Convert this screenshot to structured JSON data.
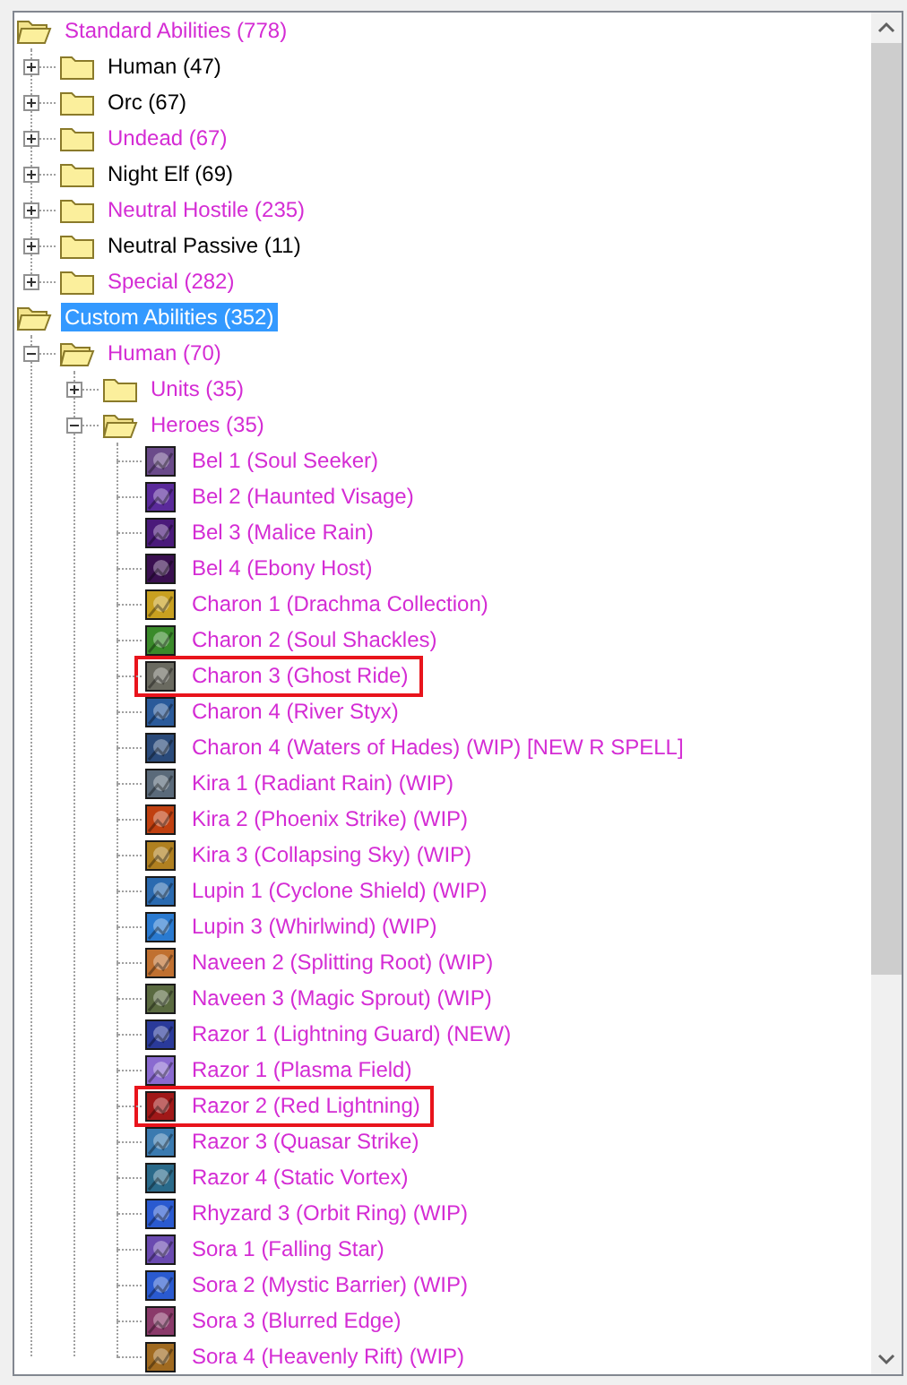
{
  "tree": [
    {
      "kind": "folder",
      "label": "Standard Abilities (778)",
      "modified": true,
      "selected": false,
      "expanded": true,
      "children": [
        {
          "kind": "folder",
          "label": "Human (47)",
          "modified": false,
          "selected": false,
          "expanded": false
        },
        {
          "kind": "folder",
          "label": "Orc (67)",
          "modified": false,
          "selected": false,
          "expanded": false
        },
        {
          "kind": "folder",
          "label": "Undead (67)",
          "modified": true,
          "selected": false,
          "expanded": false
        },
        {
          "kind": "folder",
          "label": "Night Elf (69)",
          "modified": false,
          "selected": false,
          "expanded": false
        },
        {
          "kind": "folder",
          "label": "Neutral Hostile (235)",
          "modified": true,
          "selected": false,
          "expanded": false
        },
        {
          "kind": "folder",
          "label": "Neutral Passive (11)",
          "modified": false,
          "selected": false,
          "expanded": false
        },
        {
          "kind": "folder",
          "label": "Special (282)",
          "modified": true,
          "selected": false,
          "expanded": false
        }
      ]
    },
    {
      "kind": "folder",
      "label": "Custom Abilities (352)",
      "selected": true,
      "expanded": true,
      "children": [
        {
          "kind": "folder",
          "label": "Human (70)",
          "modified": true,
          "selected": false,
          "expanded": true,
          "children": [
            {
              "kind": "folder",
              "label": "Units (35)",
              "modified": true,
              "selected": false,
              "expanded": false
            },
            {
              "kind": "folder",
              "label": "Heroes (35)",
              "modified": true,
              "selected": false,
              "expanded": true,
              "children": [
                {
                  "kind": "ability",
                  "label": "Bel 1 (Soul Seeker)",
                  "modified": true,
                  "selected": false,
                  "highlighted": false,
                  "color": "#6a4a8a"
                },
                {
                  "kind": "ability",
                  "label": "Bel 2 (Haunted Visage)",
                  "modified": true,
                  "selected": false,
                  "highlighted": false,
                  "color": "#5a2a9a"
                },
                {
                  "kind": "ability",
                  "label": "Bel 3 (Malice Rain)",
                  "modified": true,
                  "selected": false,
                  "highlighted": false,
                  "color": "#4a1a7a"
                },
                {
                  "kind": "ability",
                  "label": "Bel 4 (Ebony Host)",
                  "modified": true,
                  "selected": false,
                  "highlighted": false,
                  "color": "#3a1050"
                },
                {
                  "kind": "ability",
                  "label": "Charon 1 (Drachma Collection)",
                  "modified": true,
                  "selected": false,
                  "highlighted": false,
                  "color": "#c8a020"
                },
                {
                  "kind": "ability",
                  "label": "Charon 2 (Soul Shackles)",
                  "modified": true,
                  "selected": false,
                  "highlighted": false,
                  "color": "#3a8a2a"
                },
                {
                  "kind": "ability",
                  "label": "Charon 3 (Ghost Ride)",
                  "modified": true,
                  "selected": false,
                  "highlighted": true,
                  "color": "#6a6a60"
                },
                {
                  "kind": "ability",
                  "label": "Charon 4 (River Styx)",
                  "modified": true,
                  "selected": false,
                  "highlighted": false,
                  "color": "#2a5a9a"
                },
                {
                  "kind": "ability",
                  "label": "Charon 4 (Waters of Hades) (WIP) [NEW R SPELL]",
                  "modified": true,
                  "selected": false,
                  "highlighted": false,
                  "color": "#2a4a7a"
                },
                {
                  "kind": "ability",
                  "label": "Kira 1 (Radiant Rain) (WIP)",
                  "modified": true,
                  "selected": false,
                  "highlighted": false,
                  "color": "#5a6a7a"
                },
                {
                  "kind": "ability",
                  "label": "Kira 2 (Phoenix Strike) (WIP)",
                  "modified": true,
                  "selected": false,
                  "highlighted": false,
                  "color": "#c04010"
                },
                {
                  "kind": "ability",
                  "label": "Kira 3 (Collapsing Sky) (WIP)",
                  "modified": true,
                  "selected": false,
                  "highlighted": false,
                  "color": "#b08020"
                },
                {
                  "kind": "ability",
                  "label": "Lupin 1 (Cyclone Shield) (WIP)",
                  "modified": true,
                  "selected": false,
                  "highlighted": false,
                  "color": "#2a6ab0"
                },
                {
                  "kind": "ability",
                  "label": "Lupin 3 (Whirlwind) (WIP)",
                  "modified": true,
                  "selected": false,
                  "highlighted": false,
                  "color": "#2a7ad0"
                },
                {
                  "kind": "ability",
                  "label": "Naveen 2 (Splitting Root) (WIP)",
                  "modified": true,
                  "selected": false,
                  "highlighted": false,
                  "color": "#c07030"
                },
                {
                  "kind": "ability",
                  "label": "Naveen 3 (Magic Sprout) (WIP)",
                  "modified": true,
                  "selected": false,
                  "highlighted": false,
                  "color": "#5a6a40"
                },
                {
                  "kind": "ability",
                  "label": "Razor 1 (Lightning Guard) (NEW)",
                  "modified": true,
                  "selected": false,
                  "highlighted": false,
                  "color": "#2a3a9a"
                },
                {
                  "kind": "ability",
                  "label": "Razor 1 (Plasma Field)",
                  "modified": true,
                  "selected": false,
                  "highlighted": false,
                  "color": "#8a6ad0"
                },
                {
                  "kind": "ability",
                  "label": "Razor 2 (Red Lightning)",
                  "modified": true,
                  "selected": false,
                  "highlighted": true,
                  "color": "#a01818"
                },
                {
                  "kind": "ability",
                  "label": "Razor 3 (Quasar Strike)",
                  "modified": true,
                  "selected": false,
                  "highlighted": false,
                  "color": "#3a7ab0"
                },
                {
                  "kind": "ability",
                  "label": "Razor 4 (Static Vortex)",
                  "modified": true,
                  "selected": false,
                  "highlighted": false,
                  "color": "#2a6a8a"
                },
                {
                  "kind": "ability",
                  "label": "Rhyzard 3 (Orbit Ring) (WIP)",
                  "modified": true,
                  "selected": false,
                  "highlighted": false,
                  "color": "#2a5ad0"
                },
                {
                  "kind": "ability",
                  "label": "Sora 1 (Falling Star)",
                  "modified": true,
                  "selected": false,
                  "highlighted": false,
                  "color": "#6a4ab0"
                },
                {
                  "kind": "ability",
                  "label": "Sora 2 (Mystic Barrier) (WIP)",
                  "modified": true,
                  "selected": false,
                  "highlighted": false,
                  "color": "#2a5ad0"
                },
                {
                  "kind": "ability",
                  "label": "Sora 3 (Blurred Edge)",
                  "modified": true,
                  "selected": false,
                  "highlighted": false,
                  "color": "#8a3a6a"
                },
                {
                  "kind": "ability",
                  "label": "Sora 4 (Heavenly Rift) (WIP)",
                  "modified": true,
                  "selected": false,
                  "highlighted": false,
                  "color": "#a06a20"
                }
              ]
            }
          ]
        }
      ]
    }
  ]
}
